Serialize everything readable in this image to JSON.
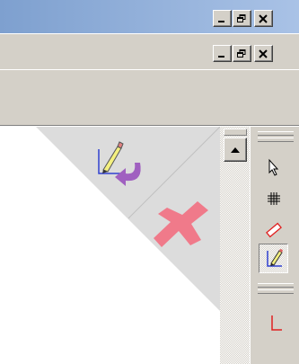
{
  "window": {
    "title_bar_buttons": [
      "minimize-icon",
      "restore-icon",
      "close-icon"
    ],
    "mdi_buttons": [
      "minimize-icon",
      "restore-icon",
      "close-icon"
    ]
  },
  "canvas": {
    "overlay_actions": [
      "undo-edit-icon",
      "delete-icon"
    ]
  },
  "palette": {
    "tools": [
      {
        "icon": "arrow-pointer-icon",
        "active": false
      },
      {
        "icon": "grid-icon",
        "active": false
      },
      {
        "icon": "ruler-icon",
        "active": false
      },
      {
        "icon": "pencil-draw-icon",
        "active": true
      },
      {
        "icon": "axis-icon",
        "active": false
      }
    ]
  },
  "colors": {
    "title_gradient_start": "#7ea0cf",
    "face": "#d4d0c8",
    "overlay": "#dcdcdc",
    "delete_red": "#f07a8a",
    "undo_purple": "#a060c0"
  }
}
